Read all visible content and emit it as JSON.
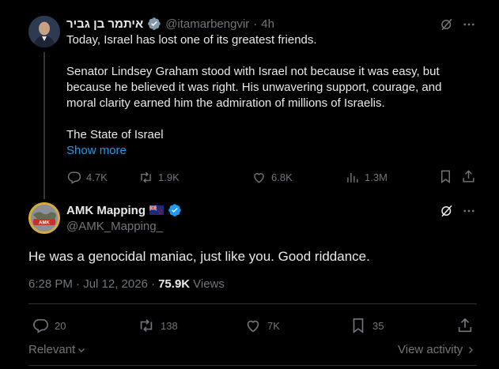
{
  "parent_tweet": {
    "display_name": "איתמר בן גביר",
    "handle": "@itamarbengvir",
    "separator": "·",
    "time": "4h",
    "paragraphs": [
      "Today, Israel has lost one of its greatest friends.",
      "Senator Lindsey Graham stood with Israel not because it was easy, but because he believed it was right. His unwavering support, courage, and moral clarity earned him the admiration of millions of Israelis.",
      "The State of Israel"
    ],
    "show_more": "Show more",
    "stats": {
      "replies": "4.7K",
      "reposts": "1.9K",
      "likes": "6.8K",
      "views": "1.3M"
    }
  },
  "reply_tweet": {
    "display_name": "AMK Mapping",
    "handle": "@AMK_Mapping_",
    "text": "He was a genocidal maniac, just like you. Good riddance.",
    "timestamp": "6:28 PM · Jul 12, 2026 ·",
    "views_count": "75.9K",
    "views_label": "Views",
    "stats": {
      "replies": "20",
      "reposts": "138",
      "likes": "7K",
      "bookmarks": "35"
    },
    "avatar_label": "AMK Mapping"
  },
  "footer": {
    "relevant": "Relevant",
    "view_activity": "View activity"
  },
  "colors": {
    "background": "#000000",
    "text": "#e7e9ea",
    "muted": "#71767b",
    "accent": "#1d9bf0",
    "divider": "#2f3336"
  },
  "icons": [
    "verified-badge-icon",
    "grok-icon",
    "more-icon",
    "reply-icon",
    "repost-icon",
    "like-icon",
    "views-icon",
    "bookmark-icon",
    "share-icon",
    "chevron-down-icon",
    "chevron-right-icon",
    "new-zealand-flag-icon"
  ]
}
